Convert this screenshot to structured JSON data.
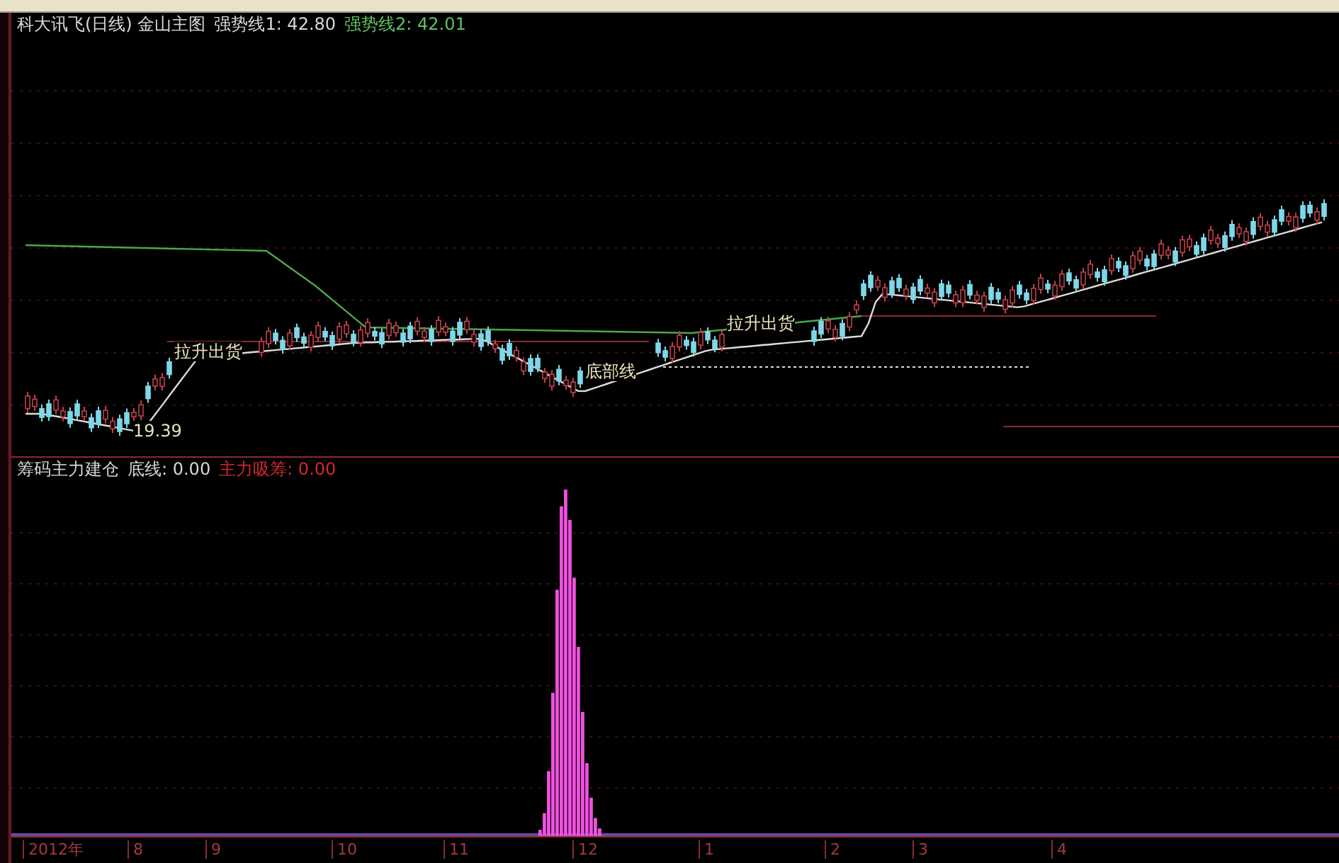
{
  "main_legend": [
    {
      "text": "科大讯飞(日线) 金山主图",
      "color": "#d8d8d8"
    },
    {
      "text": "强势线1: 42.80",
      "color": "#d8d8d8"
    },
    {
      "text": "强势线2: 42.01",
      "color": "#5fc25f"
    }
  ],
  "price_annotations": [
    {
      "text": "拉升出货"
    },
    {
      "text": "底部线"
    },
    {
      "text": "拉升出货"
    },
    {
      "text": "19.39"
    }
  ],
  "sub_legend": [
    {
      "text": "筹码主力建仓",
      "color": "#d8d8d8"
    },
    {
      "text": "底线: 0.00",
      "color": "#d8d8d8"
    },
    {
      "text": "主力吸筹: 0.00",
      "color": "#d0282e"
    }
  ],
  "x_axis_labels": [
    "2012年",
    "8",
    "9",
    "10",
    "11",
    "12",
    "1",
    "2",
    "3",
    "4"
  ]
}
